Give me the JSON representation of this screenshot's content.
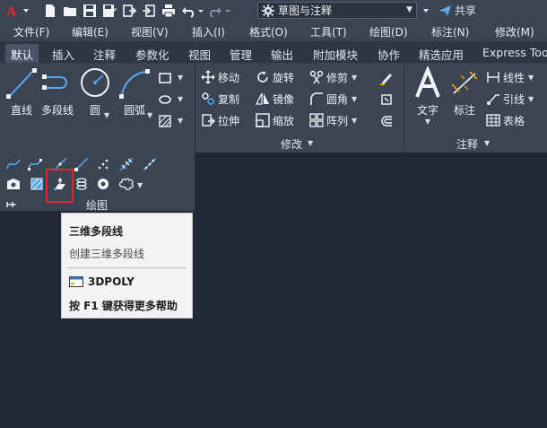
{
  "quick_access": {
    "app_logo": "A",
    "workspace": "草图与注释",
    "share_label": "共享",
    "icons": [
      "new-file-icon",
      "open-folder-icon",
      "save-icon",
      "save-as-icon",
      "import-icon",
      "export-icon",
      "print-icon",
      "undo-icon",
      "redo-icon"
    ]
  },
  "menubar": {
    "items": [
      "文件(F)",
      "编辑(E)",
      "视图(V)",
      "插入(I)",
      "格式(O)",
      "工具(T)",
      "绘图(D)",
      "标注(N)",
      "修改(M)"
    ]
  },
  "tabs": [
    "默认",
    "插入",
    "注释",
    "参数化",
    "视图",
    "管理",
    "输出",
    "附加模块",
    "协作",
    "精选应用",
    "Express Too"
  ],
  "draw_panel": {
    "title": "绘图",
    "buttons": {
      "line": "直线",
      "polyline": "多段线",
      "circle": "圆",
      "arc": "圆弧"
    }
  },
  "modify_panel": {
    "title": "修改",
    "move": "移动",
    "rotate": "旋转",
    "trim": "修剪",
    "copy": "复制",
    "mirror": "镜像",
    "fillet": "圆角",
    "stretch": "拉伸",
    "scale": "缩放",
    "array": "阵列"
  },
  "annotation_panel": {
    "title": "注释",
    "text": "文字",
    "dimension": "标注",
    "linear": "线性",
    "leader": "引线",
    "table": "表格"
  },
  "tooltip": {
    "title": "三维多段线",
    "description": "创建三维多段线",
    "command": "3DPOLY",
    "help": "按 F1 键获得更多帮助"
  },
  "colors": {
    "background": "#212836",
    "ribbon": "#3b4453",
    "highlight": "#e0262b",
    "accent_blue": "#5aa7f0"
  }
}
